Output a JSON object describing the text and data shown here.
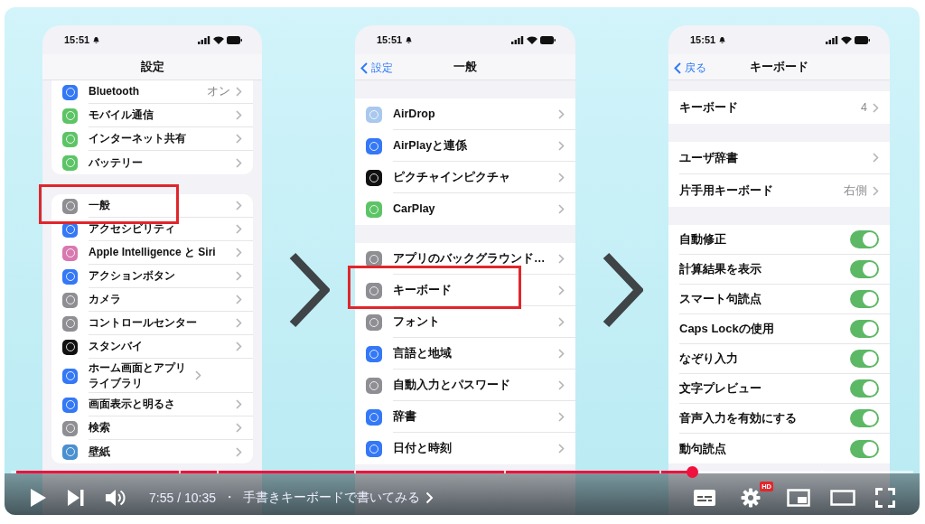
{
  "screens": [
    {
      "time": "15:51",
      "title": "設定",
      "groups": [
        {
          "rows": [
            {
              "kind": "link",
              "label": "Bluetooth",
              "value": "オン",
              "color": "#3478f6",
              "highlighted": false
            },
            {
              "kind": "link",
              "label": "モバイル通信",
              "color": "#5dc466",
              "highlighted": false
            },
            {
              "kind": "link",
              "label": "インターネット共有",
              "color": "#5dc466",
              "highlighted": false
            },
            {
              "kind": "link",
              "label": "バッテリー",
              "color": "#5dc466",
              "highlighted": false
            }
          ]
        },
        {
          "rows": [
            {
              "kind": "link",
              "label": "一般",
              "color": "#8e8e93",
              "highlighted": true
            },
            {
              "kind": "link",
              "label": "アクセシビリティ",
              "color": "#3478f6",
              "highlighted": false
            },
            {
              "kind": "link",
              "label": "Apple Intelligence と Siri",
              "color": "#d878b0",
              "highlighted": false
            },
            {
              "kind": "link",
              "label": "アクションボタン",
              "color": "#3478f6",
              "highlighted": false
            },
            {
              "kind": "link",
              "label": "カメラ",
              "color": "#8e8e93",
              "highlighted": false
            },
            {
              "kind": "link",
              "label": "コントロールセンター",
              "color": "#8e8e93",
              "highlighted": false
            },
            {
              "kind": "link",
              "label": "スタンバイ",
              "color": "#111111",
              "highlighted": false
            },
            {
              "kind": "link",
              "label": "ホーム画面とアプリライブラリ",
              "color": "#3478f6",
              "highlighted": false
            },
            {
              "kind": "link",
              "label": "画面表示と明るさ",
              "color": "#3478f6",
              "highlighted": false
            },
            {
              "kind": "link",
              "label": "検索",
              "color": "#8e8e93",
              "highlighted": false
            },
            {
              "kind": "link",
              "label": "壁紙",
              "color": "#4a90d0",
              "highlighted": false
            }
          ]
        }
      ]
    },
    {
      "time": "15:51",
      "back": "設定",
      "title": "一般",
      "groups": [
        {
          "rows": [
            {
              "kind": "link",
              "label": "AirDrop",
              "color": "#a9c8ee",
              "highlighted": false
            },
            {
              "kind": "link",
              "label": "AirPlayと連係",
              "color": "#3478f6",
              "highlighted": false
            },
            {
              "kind": "link",
              "label": "ピクチャインピクチャ",
              "color": "#111111",
              "highlighted": false
            },
            {
              "kind": "link",
              "label": "CarPlay",
              "color": "#5dc466",
              "highlighted": false
            }
          ]
        },
        {
          "rows": [
            {
              "kind": "link",
              "label": "アプリのバックグラウンド…",
              "color": "#8e8e93",
              "highlighted": false
            },
            {
              "kind": "link",
              "label": "キーボード",
              "color": "#8e8e93",
              "highlighted": true
            },
            {
              "kind": "link",
              "label": "フォント",
              "color": "#8e8e93",
              "highlighted": false
            },
            {
              "kind": "link",
              "label": "言語と地域",
              "color": "#3478f6",
              "highlighted": false
            },
            {
              "kind": "link",
              "label": "自動入力とパスワード",
              "color": "#8e8e93",
              "highlighted": false
            },
            {
              "kind": "link",
              "label": "辞書",
              "color": "#3478f6",
              "highlighted": false
            },
            {
              "kind": "link",
              "label": "日付と時刻",
              "color": "#3478f6",
              "highlighted": false
            }
          ]
        }
      ]
    },
    {
      "time": "15:51",
      "back": "戻る",
      "title": "キーボード",
      "groups": [
        {
          "rows": [
            {
              "kind": "link",
              "label": "キーボード",
              "value": "4",
              "highlighted": false
            }
          ]
        },
        {
          "rows": [
            {
              "kind": "link",
              "label": "ユーザ辞書",
              "highlighted": false
            },
            {
              "kind": "link",
              "label": "片手用キーボード",
              "value": "右側",
              "highlighted": false
            }
          ]
        },
        {
          "rows": [
            {
              "kind": "toggle",
              "label": "自動修正",
              "on": true,
              "highlighted": false
            },
            {
              "kind": "toggle",
              "label": "計算結果を表示",
              "on": true,
              "highlighted": false
            },
            {
              "kind": "toggle",
              "label": "スマート句読点",
              "on": true,
              "highlighted": false
            },
            {
              "kind": "toggle",
              "label": "Caps Lockの使用",
              "on": true,
              "highlighted": false
            },
            {
              "kind": "toggle",
              "label": "なぞり入力",
              "on": true,
              "highlighted": false
            },
            {
              "kind": "toggle",
              "label": "文字プレビュー",
              "on": true,
              "highlighted": false
            },
            {
              "kind": "toggle",
              "label": "音声入力を有効にする",
              "on": true,
              "highlighted": false
            },
            {
              "kind": "toggle",
              "label": "動句読点",
              "on": true,
              "highlighted": false
            }
          ]
        }
      ]
    }
  ],
  "player": {
    "level": 0.749,
    "time": "7:55 / 10:35",
    "separator": "・",
    "chapter": "手書きキーボードで書いてみる",
    "quality_badge": "HD"
  }
}
